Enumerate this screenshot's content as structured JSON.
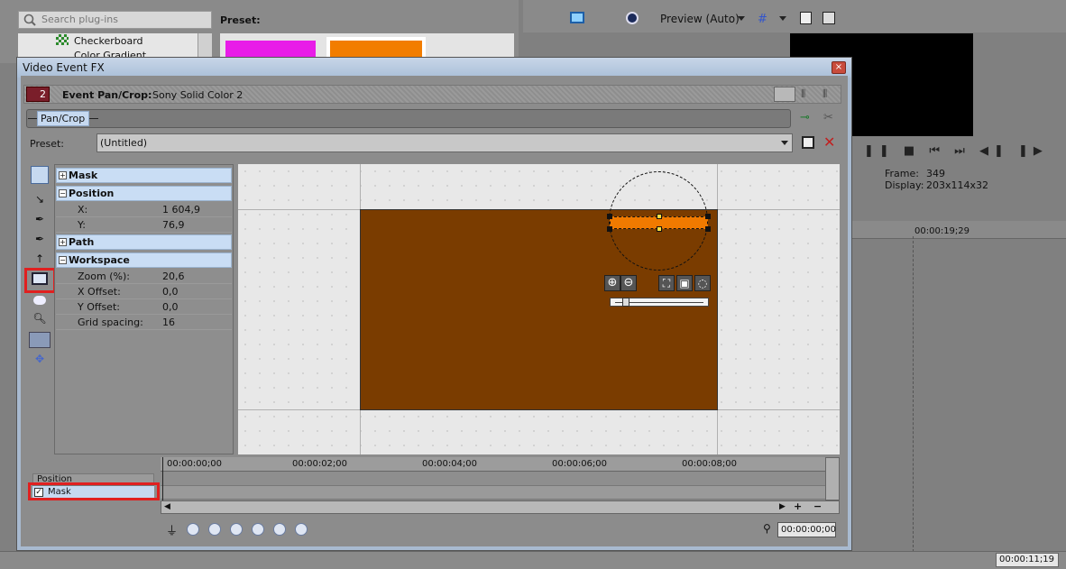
{
  "plugins": {
    "search_placeholder": "Search plug-ins",
    "items": [
      "Checkerboard",
      "Color Gradient"
    ]
  },
  "preset_header": "Preset:",
  "preview": {
    "label": "Preview (Auto)",
    "frame_label": "Frame:",
    "frame_value": "349",
    "display_label": "Display:",
    "display_value": "203x114x32"
  },
  "timeline_bg": {
    "timecode": "00:00:19;29",
    "bottom_time": "00:00:11;19"
  },
  "dialog": {
    "title": "Video Event FX",
    "fx_count": "2",
    "event_label": "Event Pan/Crop:",
    "event_name": "Sony Solid Color 2",
    "chain_item": "Pan/Crop",
    "preset_label": "Preset:",
    "preset_value": "(Untitled)",
    "close_glyph": "×"
  },
  "properties": {
    "mask": "Mask",
    "position": "Position",
    "x_label": "X:",
    "x_value": "1 604,9",
    "y_label": "Y:",
    "y_value": "76,9",
    "path": "Path",
    "workspace": "Workspace",
    "zoom_label": "Zoom (%):",
    "zoom_value": "20,6",
    "xoff_label": "X Offset:",
    "xoff_value": "0,0",
    "yoff_label": "Y Offset:",
    "yoff_value": "0,0",
    "grid_label": "Grid spacing:",
    "grid_value": "16"
  },
  "keyframe_timeline": {
    "ticks": [
      "00:00:00;00",
      "00:00:02;00",
      "00:00:04;00",
      "00:00:06;00",
      "00:00:08;00"
    ],
    "track_position": "Position",
    "track_mask": "Mask",
    "cursor_time": "00:00:00;00"
  },
  "colors": {
    "media_fill": "#7a3c00",
    "mask_bar": "#f07a00",
    "highlight_red": "#e02020",
    "swatch_magenta": "#e81ce8",
    "swatch_orange": "#f27d00"
  }
}
